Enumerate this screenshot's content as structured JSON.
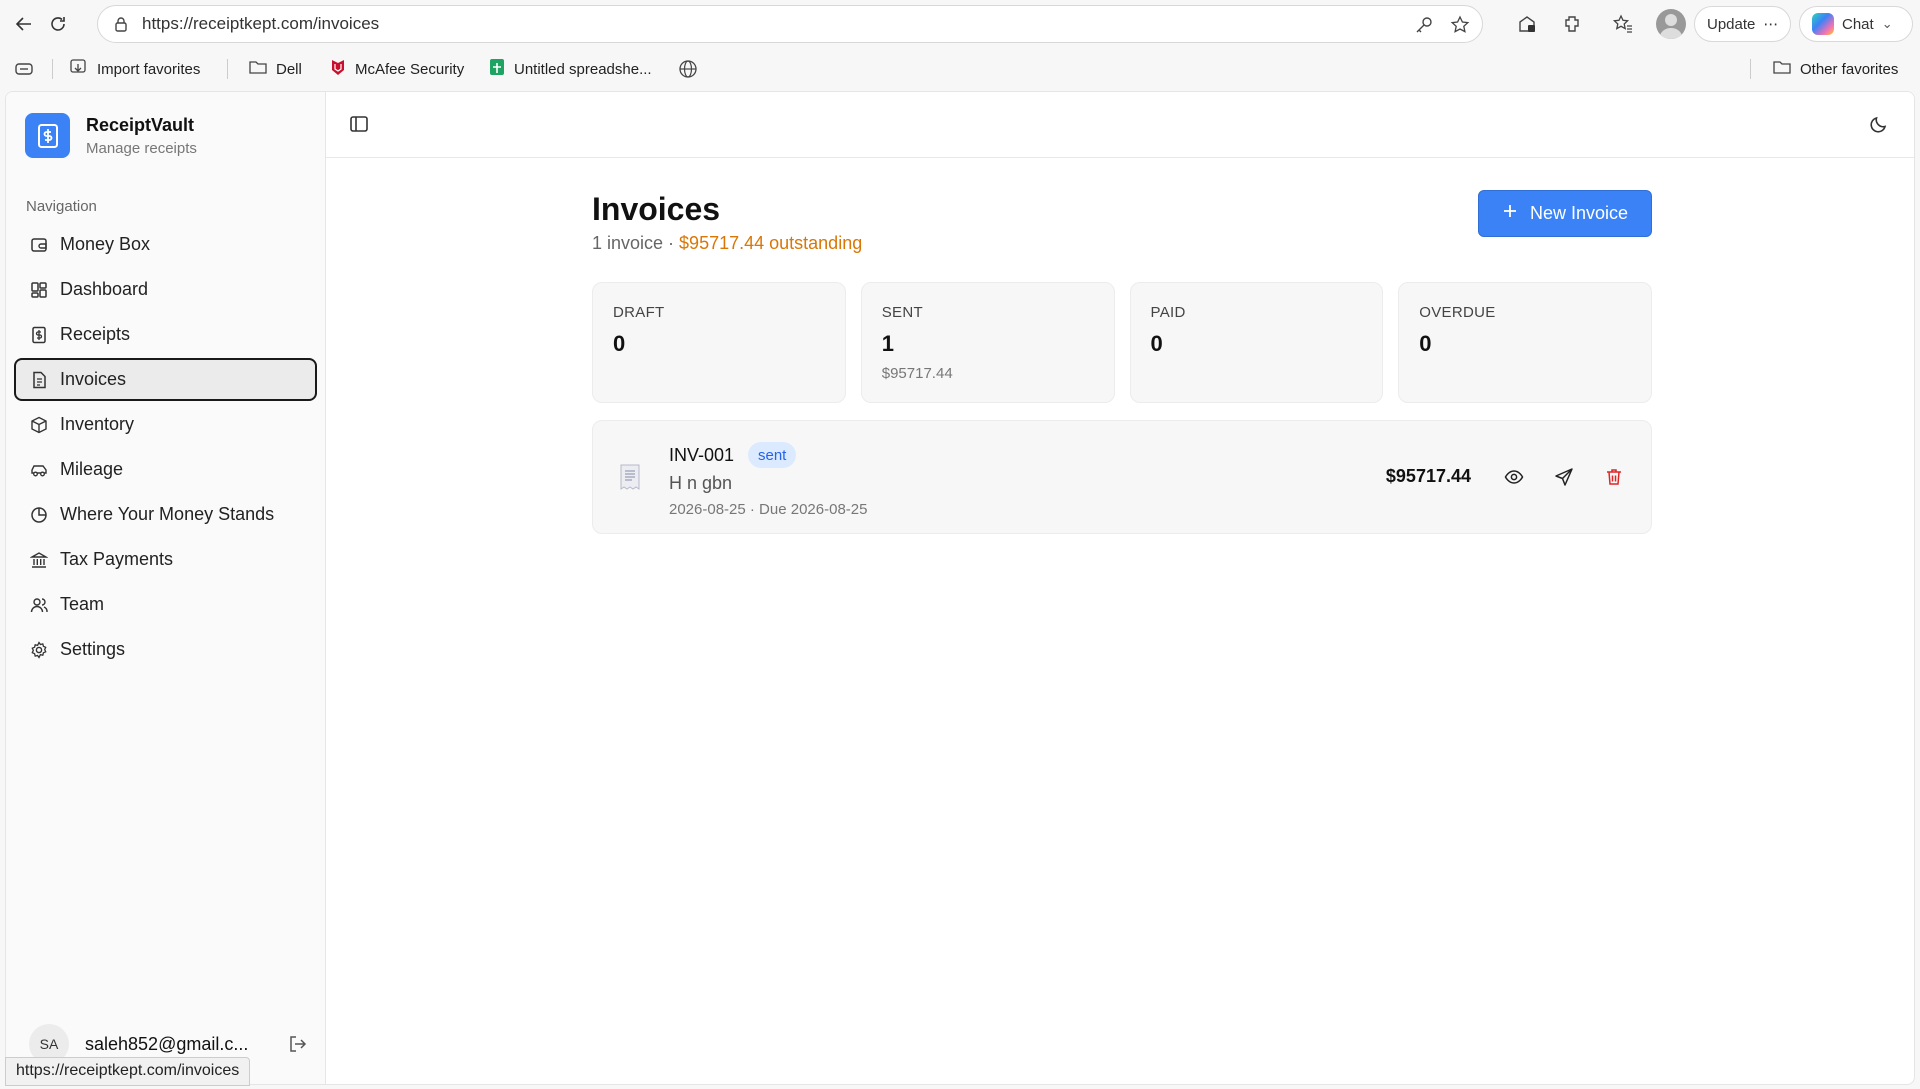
{
  "browser": {
    "url": "https://receiptkept.com/invoices",
    "update_label": "Update",
    "chat_label": "Chat",
    "status_url": "https://receiptkept.com/invoices"
  },
  "bookmarks": {
    "import": "Import favorites",
    "dell": "Dell",
    "mcafee": "McAfee Security",
    "spreadsheet": "Untitled spreadshe...",
    "other": "Other favorites"
  },
  "sidebar": {
    "brand_name": "ReceiptVault",
    "brand_sub": "Manage receipts",
    "nav_heading": "Navigation",
    "items": [
      {
        "label": "Money Box",
        "icon": "wallet-icon"
      },
      {
        "label": "Dashboard",
        "icon": "dashboard-icon"
      },
      {
        "label": "Receipts",
        "icon": "receipt-icon"
      },
      {
        "label": "Invoices",
        "icon": "invoice-icon",
        "active": true
      },
      {
        "label": "Inventory",
        "icon": "box-icon"
      },
      {
        "label": "Mileage",
        "icon": "car-icon"
      },
      {
        "label": "Where Your Money Stands",
        "icon": "pie-chart-icon"
      },
      {
        "label": "Tax Payments",
        "icon": "bank-icon"
      },
      {
        "label": "Team",
        "icon": "users-icon"
      },
      {
        "label": "Settings",
        "icon": "gear-icon"
      }
    ],
    "user_initials": "SA",
    "user_email": "saleh852@gmail.c..."
  },
  "main": {
    "title": "Invoices",
    "count_text": "1 invoice · ",
    "outstanding_text": "$95717.44 outstanding",
    "new_invoice_label": "New Invoice",
    "stats": [
      {
        "label": "DRAFT",
        "value": "0",
        "amount": ""
      },
      {
        "label": "SENT",
        "value": "1",
        "amount": "$95717.44"
      },
      {
        "label": "PAID",
        "value": "0",
        "amount": ""
      },
      {
        "label": "OVERDUE",
        "value": "0",
        "amount": ""
      }
    ],
    "invoices": [
      {
        "number": "INV-001",
        "status": "sent",
        "client": "H n gbn",
        "dates": "2026-08-25 · Due 2026-08-25",
        "amount": "$95717.44"
      }
    ]
  },
  "colors": {
    "accent": "#3b82f6",
    "outstanding": "#d97706",
    "badge_bg": "#dbeafe",
    "delete": "#dc2626"
  }
}
